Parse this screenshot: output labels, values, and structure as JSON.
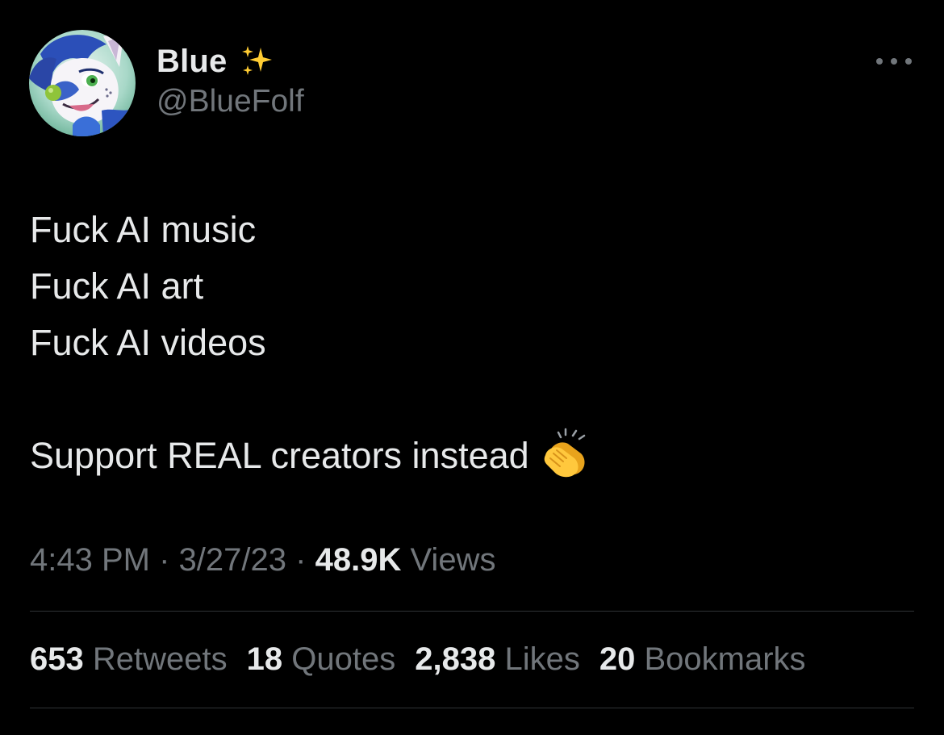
{
  "author": {
    "display_name": "Blue",
    "name_emoji": "sparkles-icon",
    "handle": "@BlueFolf"
  },
  "tweet": {
    "lines": [
      "Fuck AI music",
      "Fuck AI art",
      "Fuck AI videos",
      "",
      "Support REAL creators instead"
    ],
    "trailing_emoji": "clapping-hands-icon"
  },
  "meta": {
    "time": "4:43 PM",
    "separator": "·",
    "date": "3/27/23",
    "views_count": "48.9K",
    "views_label": "Views"
  },
  "stats": [
    {
      "count": "653",
      "label": "Retweets"
    },
    {
      "count": "18",
      "label": "Quotes"
    },
    {
      "count": "2,838",
      "label": "Likes"
    },
    {
      "count": "20",
      "label": "Bookmarks"
    }
  ],
  "colors": {
    "background": "#000000",
    "primary_text": "#e7e9ea",
    "secondary_text": "#71767b",
    "divider": "#2f3336",
    "sparkle": "#ffcc33"
  }
}
